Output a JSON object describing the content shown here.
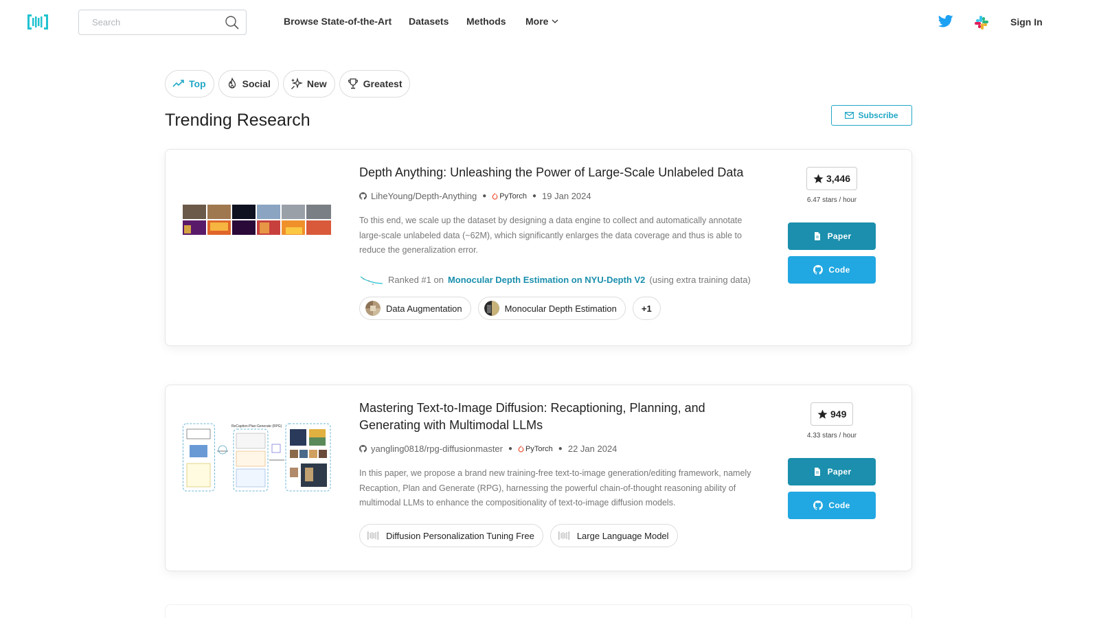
{
  "nav": {
    "search_placeholder": "Search",
    "links": [
      "Browse State-of-the-Art",
      "Datasets",
      "Methods",
      "More"
    ],
    "sign_in": "Sign In"
  },
  "tabs": [
    {
      "label": "Top",
      "icon": "trending-up-icon",
      "active": true
    },
    {
      "label": "Social",
      "icon": "flame-icon",
      "active": false
    },
    {
      "label": "New",
      "icon": "sparkles-icon",
      "active": false
    },
    {
      "label": "Greatest",
      "icon": "trophy-icon",
      "active": false
    }
  ],
  "page_title": "Trending Research",
  "subscribe_label": "Subscribe",
  "papers": [
    {
      "title": "Depth Anything: Unleashing the Power of Large-Scale Unlabeled Data",
      "repo": "LiheYoung/Depth-Anything",
      "framework": "PyTorch",
      "date": "19 Jan 2024",
      "abstract": "To this end, we scale up the dataset by designing a data engine to collect and automatically annotate large-scale unlabeled data (~62M), which significantly enlarges the data coverage and thus is able to reduce the generalization error.",
      "ranked_prefix": "Ranked #1 on",
      "ranked_task": "Monocular Depth Estimation on NYU-Depth V2",
      "ranked_suffix": "(using extra training data)",
      "tasks": [
        "Data Augmentation",
        "Monocular Depth Estimation"
      ],
      "more_tasks": "+1",
      "stars": "3,446",
      "stars_rate": "6.47 stars / hour",
      "paper_label": "Paper",
      "code_label": "Code"
    },
    {
      "title": "Mastering Text-to-Image Diffusion: Recaptioning, Planning, and Generating with Multimodal LLMs",
      "repo": "yangling0818/rpg-diffusionmaster",
      "framework": "PyTorch",
      "date": "22 Jan 2024",
      "abstract": "In this paper, we propose a brand new training-free text-to-image generation/editing framework, namely Recaption, Plan and Generate (RPG), harnessing the powerful chain-of-thought reasoning ability of multimodal LLMs to enhance the compositionality of text-to-image diffusion models.",
      "tasks": [
        "Diffusion Personalization Tuning Free",
        "Large Language Model"
      ],
      "stars": "949",
      "stars_rate": "4.33 stars / hour",
      "paper_label": "Paper",
      "code_label": "Code"
    }
  ],
  "colors": {
    "accent": "#21a7c6",
    "paper_button": "#1b8fad",
    "code_button": "#21a7e1",
    "twitter": "#1da1f2"
  }
}
